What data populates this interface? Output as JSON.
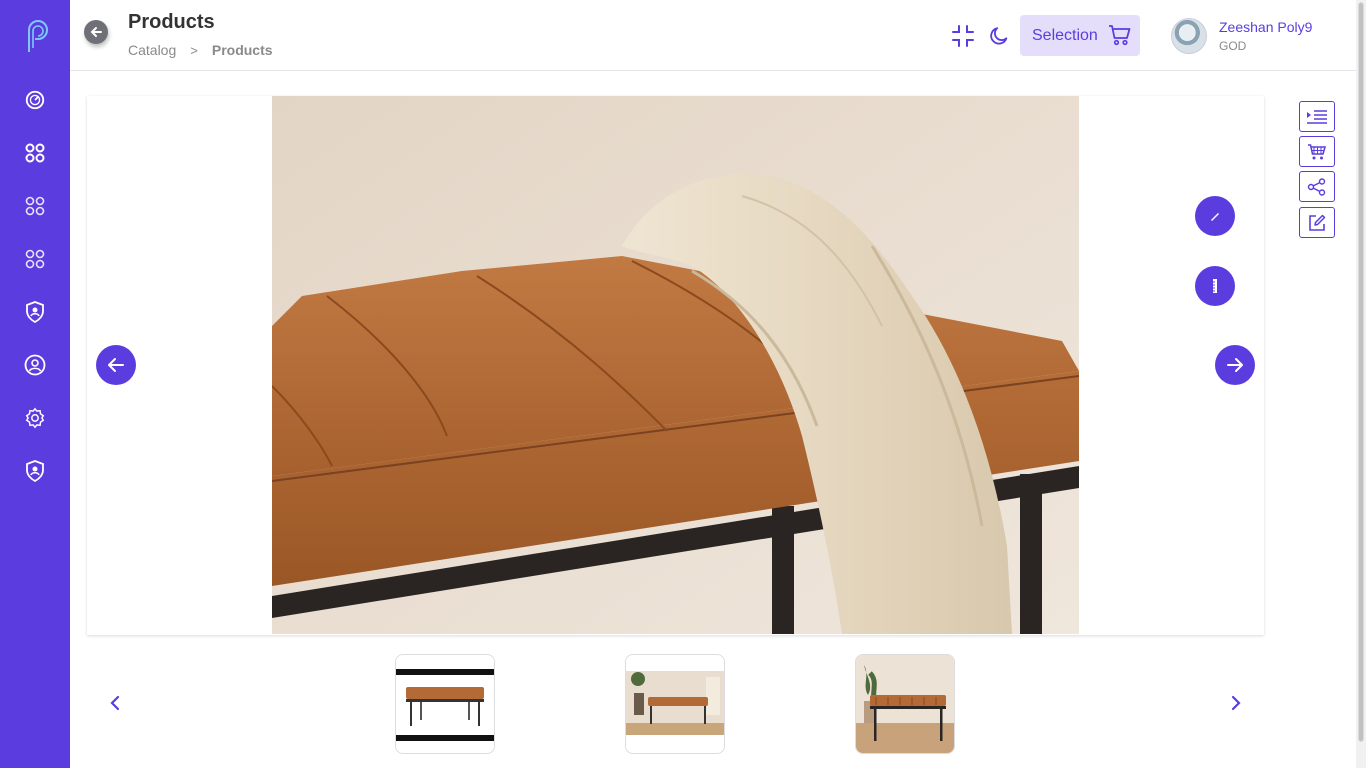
{
  "header": {
    "title": "Products",
    "breadcrumb": {
      "parent": "Catalog",
      "separator": ">",
      "current": "Products"
    },
    "selection_label": "Selection"
  },
  "user": {
    "name": "Zeeshan Poly9",
    "role": "GOD"
  },
  "sidebar": {
    "items": [
      {
        "icon": "dashboard-gauge-icon"
      },
      {
        "icon": "grid-apps-icon"
      },
      {
        "icon": "grid-apps-icon"
      },
      {
        "icon": "grid-apps-icon"
      },
      {
        "icon": "shield-user-icon"
      },
      {
        "icon": "user-circle-icon"
      },
      {
        "icon": "gear-icon"
      },
      {
        "icon": "shield-user-icon"
      }
    ]
  },
  "viewer": {
    "actions": [
      "list-indent-icon",
      "cart-icon",
      "share-icon",
      "edit-icon"
    ],
    "thumbnails": [
      {
        "alt": "bench white background"
      },
      {
        "alt": "bench in room with plant"
      },
      {
        "alt": "bench with plant wooden floor",
        "selected": true
      }
    ]
  },
  "colors": {
    "accent": "#5b3ddf",
    "accent_light": "#e4defb",
    "leather": "#b8703d"
  }
}
